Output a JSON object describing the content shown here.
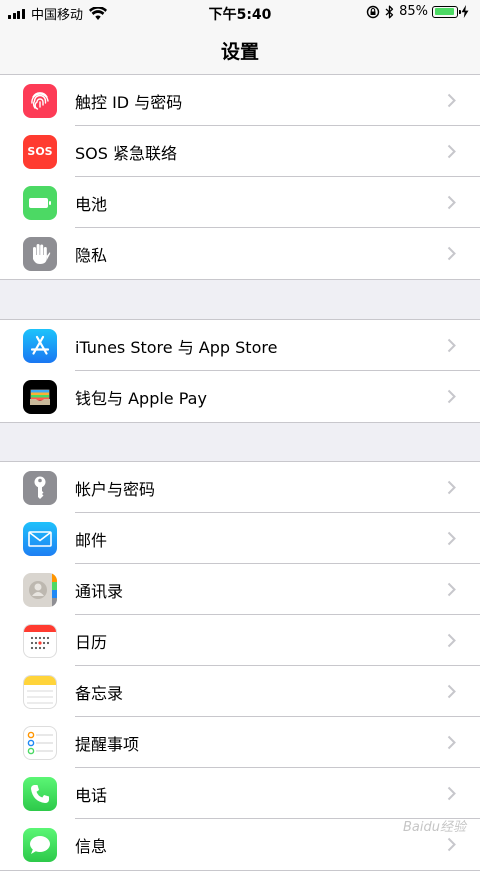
{
  "status_bar": {
    "carrier": "中国移动",
    "time": "下午5:40",
    "battery_percent": "85%",
    "battery_level": 0.85
  },
  "navbar": {
    "title": "设置"
  },
  "groups": [
    [
      {
        "label": "触控 ID 与密码",
        "icon": "fingerprint-icon",
        "color": "#fd3b56"
      },
      {
        "label": "SOS 紧急联络",
        "icon": "sos-icon",
        "color": "#ff3b30",
        "icon_text": "SOS"
      },
      {
        "label": "电池",
        "icon": "battery-icon",
        "color": "#4cd964"
      },
      {
        "label": "隐私",
        "icon": "hand-icon",
        "color": "#8e8e93"
      }
    ],
    [
      {
        "label": "iTunes Store 与 App Store",
        "icon": "app-store-icon",
        "color": "#1a8cfb"
      },
      {
        "label": "钱包与 Apple Pay",
        "icon": "wallet-icon",
        "color": "#000000"
      }
    ],
    [
      {
        "label": "帐户与密码",
        "icon": "key-icon",
        "color": "#8e8e93"
      },
      {
        "label": "邮件",
        "icon": "mail-icon",
        "color": "#1e88f5"
      },
      {
        "label": "通讯录",
        "icon": "contacts-icon",
        "color": "#d6d2cc"
      },
      {
        "label": "日历",
        "icon": "calendar-icon",
        "color": "#ffffff"
      },
      {
        "label": "备忘录",
        "icon": "notes-icon",
        "color": "#ffffff"
      },
      {
        "label": "提醒事项",
        "icon": "reminders-icon",
        "color": "#ffffff"
      },
      {
        "label": "电话",
        "icon": "phone-icon",
        "color": "#4cd964"
      },
      {
        "label": "信息",
        "icon": "messages-icon",
        "color": "#4cd964"
      }
    ]
  ],
  "watermark": "Baidu经验"
}
